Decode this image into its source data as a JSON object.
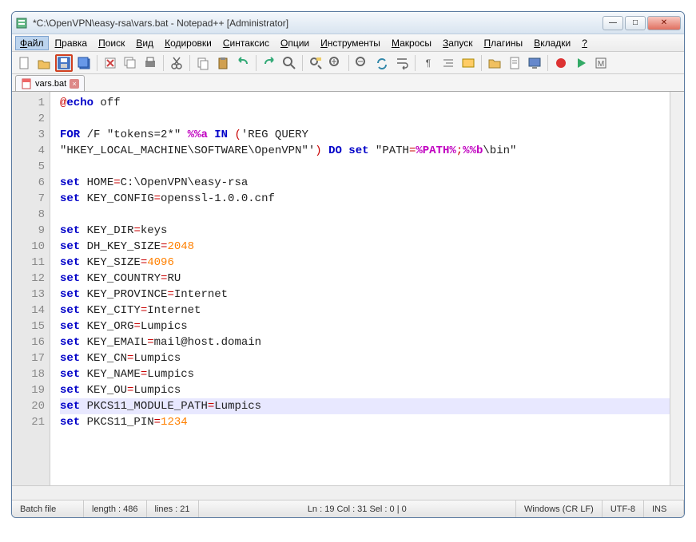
{
  "window": {
    "title": "*C:\\OpenVPN\\easy-rsa\\vars.bat - Notepad++ [Administrator]"
  },
  "menu": {
    "items": [
      "Файл",
      "Правка",
      "Поиск",
      "Вид",
      "Кодировки",
      "Синтаксис",
      "Опции",
      "Инструменты",
      "Макросы",
      "Запуск",
      "Плагины",
      "Вкладки",
      "?"
    ],
    "selected_index": 0
  },
  "tab": {
    "label": "vars.bat"
  },
  "code": {
    "current_line": 19,
    "lines": [
      {
        "n": 1,
        "tokens": [
          {
            "t": "@",
            "c": "op"
          },
          {
            "t": "echo",
            "c": "kw"
          },
          {
            "t": " off",
            "c": "txt"
          }
        ]
      },
      {
        "n": 2,
        "tokens": []
      },
      {
        "n": 3,
        "tokens": [
          {
            "t": "FOR",
            "c": "kw"
          },
          {
            "t": " /F ",
            "c": "txt"
          },
          {
            "t": "\"tokens=2*\"",
            "c": "txt"
          },
          {
            "t": " ",
            "c": "txt"
          },
          {
            "t": "%%a",
            "c": "pct"
          },
          {
            "t": " ",
            "c": "txt"
          },
          {
            "t": "IN",
            "c": "kw"
          },
          {
            "t": " (",
            "c": "op"
          },
          {
            "t": "'REG QUERY",
            "c": "txt"
          }
        ]
      },
      {
        "n": null,
        "tokens": [
          {
            "t": "\"HKEY_LOCAL_MACHINE\\SOFTWARE\\OpenVPN\"'",
            "c": "txt"
          },
          {
            "t": ")",
            "c": "op"
          },
          {
            "t": " ",
            "c": "txt"
          },
          {
            "t": "DO",
            "c": "kw"
          },
          {
            "t": " ",
            "c": "txt"
          },
          {
            "t": "set",
            "c": "kw"
          },
          {
            "t": " \"PATH",
            "c": "txt"
          },
          {
            "t": "=",
            "c": "op"
          },
          {
            "t": "%PATH%",
            "c": "pct"
          },
          {
            "t": ";",
            "c": "op"
          },
          {
            "t": "%%b",
            "c": "pct"
          },
          {
            "t": "\\bin\"",
            "c": "txt"
          }
        ]
      },
      {
        "n": 4,
        "tokens": []
      },
      {
        "n": 5,
        "tokens": [
          {
            "t": "set",
            "c": "kw"
          },
          {
            "t": " HOME",
            "c": "txt"
          },
          {
            "t": "=",
            "c": "op"
          },
          {
            "t": "C:\\OpenVPN\\easy-rsa",
            "c": "txt"
          }
        ]
      },
      {
        "n": 6,
        "tokens": [
          {
            "t": "set",
            "c": "kw"
          },
          {
            "t": " KEY_CONFIG",
            "c": "txt"
          },
          {
            "t": "=",
            "c": "op"
          },
          {
            "t": "openssl-1.0.0.cnf",
            "c": "txt"
          }
        ]
      },
      {
        "n": 7,
        "tokens": []
      },
      {
        "n": 8,
        "tokens": [
          {
            "t": "set",
            "c": "kw"
          },
          {
            "t": " KEY_DIR",
            "c": "txt"
          },
          {
            "t": "=",
            "c": "op"
          },
          {
            "t": "keys",
            "c": "txt"
          }
        ]
      },
      {
        "n": 9,
        "tokens": [
          {
            "t": "set",
            "c": "kw"
          },
          {
            "t": " DH_KEY_SIZE",
            "c": "txt"
          },
          {
            "t": "=",
            "c": "op"
          },
          {
            "t": "2048",
            "c": "num"
          }
        ]
      },
      {
        "n": 10,
        "tokens": [
          {
            "t": "set",
            "c": "kw"
          },
          {
            "t": " KEY_SIZE",
            "c": "txt"
          },
          {
            "t": "=",
            "c": "op"
          },
          {
            "t": "4096",
            "c": "num"
          }
        ]
      },
      {
        "n": 11,
        "tokens": [
          {
            "t": "set",
            "c": "kw"
          },
          {
            "t": " KEY_COUNTRY",
            "c": "txt"
          },
          {
            "t": "=",
            "c": "op"
          },
          {
            "t": "RU",
            "c": "txt"
          }
        ]
      },
      {
        "n": 12,
        "tokens": [
          {
            "t": "set",
            "c": "kw"
          },
          {
            "t": " KEY_PROVINCE",
            "c": "txt"
          },
          {
            "t": "=",
            "c": "op"
          },
          {
            "t": "Internet",
            "c": "txt"
          }
        ]
      },
      {
        "n": 13,
        "tokens": [
          {
            "t": "set",
            "c": "kw"
          },
          {
            "t": " KEY_CITY",
            "c": "txt"
          },
          {
            "t": "=",
            "c": "op"
          },
          {
            "t": "Internet",
            "c": "txt"
          }
        ]
      },
      {
        "n": 14,
        "tokens": [
          {
            "t": "set",
            "c": "kw"
          },
          {
            "t": " KEY_ORG",
            "c": "txt"
          },
          {
            "t": "=",
            "c": "op"
          },
          {
            "t": "Lumpics",
            "c": "txt"
          }
        ]
      },
      {
        "n": 15,
        "tokens": [
          {
            "t": "set",
            "c": "kw"
          },
          {
            "t": " KEY_EMAIL",
            "c": "txt"
          },
          {
            "t": "=",
            "c": "op"
          },
          {
            "t": "mail@host.domain",
            "c": "txt"
          }
        ]
      },
      {
        "n": 16,
        "tokens": [
          {
            "t": "set",
            "c": "kw"
          },
          {
            "t": " KEY_CN",
            "c": "txt"
          },
          {
            "t": "=",
            "c": "op"
          },
          {
            "t": "Lumpics",
            "c": "txt"
          }
        ]
      },
      {
        "n": 17,
        "tokens": [
          {
            "t": "set",
            "c": "kw"
          },
          {
            "t": " KEY_NAME",
            "c": "txt"
          },
          {
            "t": "=",
            "c": "op"
          },
          {
            "t": "Lumpics",
            "c": "txt"
          }
        ]
      },
      {
        "n": 18,
        "tokens": [
          {
            "t": "set",
            "c": "kw"
          },
          {
            "t": " KEY_OU",
            "c": "txt"
          },
          {
            "t": "=",
            "c": "op"
          },
          {
            "t": "Lumpics",
            "c": "txt"
          }
        ]
      },
      {
        "n": 19,
        "tokens": [
          {
            "t": "set",
            "c": "kw"
          },
          {
            "t": " PKCS11_MODULE_PATH",
            "c": "txt"
          },
          {
            "t": "=",
            "c": "op"
          },
          {
            "t": "Lumpics",
            "c": "txt"
          }
        ]
      },
      {
        "n": 20,
        "tokens": [
          {
            "t": "set",
            "c": "kw"
          },
          {
            "t": " PKCS11_PIN",
            "c": "txt"
          },
          {
            "t": "=",
            "c": "op"
          },
          {
            "t": "1234",
            "c": "num"
          }
        ]
      },
      {
        "n": 21,
        "tokens": []
      }
    ]
  },
  "status": {
    "filetype": "Batch file",
    "length_label": "length : 486",
    "lines_label": "lines : 21",
    "pos_label": "Ln : 19   Col : 31   Sel : 0 | 0",
    "eol_label": "Windows (CR LF)",
    "enc_label": "UTF-8",
    "mode_label": "INS"
  },
  "toolbar_icons": [
    "new",
    "open",
    "save",
    "save-all",
    "close",
    "close-all",
    "print",
    "cut",
    "copy",
    "paste",
    "undo",
    "redo",
    "find",
    "replace",
    "zoom-in",
    "zoom-out",
    "sync",
    "wrap",
    "ws",
    "indent",
    "lang",
    "folder",
    "doc",
    "monitor",
    "rec",
    "play",
    "macro"
  ]
}
